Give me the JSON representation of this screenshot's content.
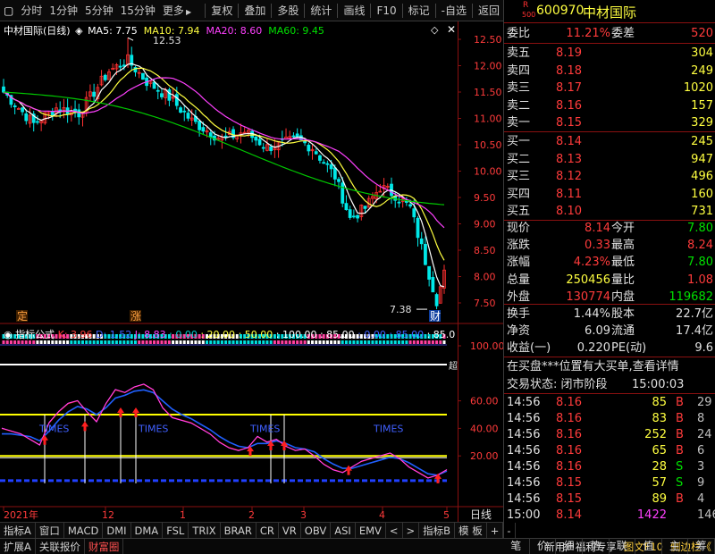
{
  "toolbar": {
    "periods": [
      "分时",
      "1分钟",
      "5分钟",
      "15分钟",
      "更多"
    ],
    "more_arrow": "▶",
    "tools": [
      "复权",
      "叠加",
      "多股",
      "统计",
      "画线",
      "F10",
      "标记",
      "-自选",
      "返回"
    ]
  },
  "main_legend": {
    "title": "中材国际(日线)",
    "ma5": "MA5: 7.75",
    "ma10": "MA10: 7.94",
    "ma20": "MA20: 8.60",
    "ma60": "MA60: 9.45"
  },
  "price_axis": [
    "12.50",
    "12.00",
    "11.50",
    "11.00",
    "10.50",
    "10.00",
    "9.50",
    "9.00",
    "8.50",
    "8.00",
    "7.50"
  ],
  "annotations": {
    "high": "12.53",
    "low": "7.38",
    "marker_ding": "定",
    "marker_zhang": "涨",
    "marker_cai": "财"
  },
  "ind_legend": {
    "name": "指标公式",
    "k": "K: 3.96",
    "d": "D: 1.52",
    "j": "J: 8.83",
    "v1": ": 0.00",
    "v2": ": 20.00",
    "v3": ": 50.00",
    "v4": ": 100.00",
    "v5": ": 85.00",
    "v6": ": 0.00",
    "v7": ": 85.00",
    "v8": ": 85.0"
  },
  "ind_axis": [
    "100.00",
    "60.00",
    "40.00",
    "20.00"
  ],
  "ind_labels": {
    "times": "TIMES",
    "side": "超"
  },
  "date_axis": [
    "2021年",
    "12",
    "1",
    "2",
    "3",
    "4",
    "5"
  ],
  "date_axis_right": "日线",
  "bottom_tabs": [
    "指标A",
    "窗口",
    "MACD",
    "DMI",
    "DMA",
    "FSL",
    "TRIX",
    "BRAR",
    "CR",
    "VR",
    "OBV",
    "ASI",
    "EMV",
    "<",
    ">",
    "指标B",
    "模 板",
    "+",
    "-"
  ],
  "status_tabs": [
    "扩展A",
    "关联报价",
    "财富圈"
  ],
  "status_news": "新用户福利专享",
  "status_f10": "图文F10",
  "status_side": "侧边栏《",
  "right_tabs": [
    "笔",
    "价",
    "细",
    "势",
    "联",
    "值",
    "主",
    "筹"
  ],
  "stock": {
    "r_label": "R",
    "code_num": "500",
    "code": "600970",
    "name": "中材国际"
  },
  "weibi": {
    "label": "委比",
    "value": "11.21%",
    "label2": "委差",
    "value2": "520"
  },
  "sell": [
    {
      "label": "卖五",
      "price": "8.19",
      "vol": "304"
    },
    {
      "label": "卖四",
      "price": "8.18",
      "vol": "249"
    },
    {
      "label": "卖三",
      "price": "8.17",
      "vol": "1020"
    },
    {
      "label": "卖二",
      "price": "8.16",
      "vol": "157"
    },
    {
      "label": "卖一",
      "price": "8.15",
      "vol": "329"
    }
  ],
  "buy": [
    {
      "label": "买一",
      "price": "8.14",
      "vol": "245"
    },
    {
      "label": "买二",
      "price": "8.13",
      "vol": "947"
    },
    {
      "label": "买三",
      "price": "8.12",
      "vol": "496"
    },
    {
      "label": "买四",
      "price": "8.11",
      "vol": "160"
    },
    {
      "label": "买五",
      "price": "8.10",
      "vol": "731"
    }
  ],
  "quote": [
    {
      "l1": "现价",
      "v1": "8.14",
      "l2": "今开",
      "v2": "7.80"
    },
    {
      "l1": "涨跌",
      "v1": "0.33",
      "l2": "最高",
      "v2": "8.24"
    },
    {
      "l1": "涨幅",
      "v1": "4.23%",
      "l2": "最低",
      "v2": "7.80"
    },
    {
      "l1": "总量",
      "v1": "250456",
      "l2": "量比",
      "v2": "1.08"
    },
    {
      "l1": "外盘",
      "v1": "130774",
      "l2": "内盘",
      "v2": "119682"
    }
  ],
  "stats": [
    {
      "l1": "换手",
      "v1": "1.44%",
      "l2": "股本",
      "v2": "22.7亿"
    },
    {
      "l1": "净资",
      "v1": "6.09",
      "l2": "流通",
      "v2": "17.4亿"
    },
    {
      "l1": "收益(一)",
      "v1": "0.220",
      "l2": "PE(动)",
      "v2": "9.6"
    }
  ],
  "notice": "在买盘***位置有大买单,查看详情",
  "trade_status": {
    "label": "交易状态: 闭市阶段",
    "time": "15:00:03"
  },
  "ticks": [
    {
      "t": "14:56",
      "p": "8.16",
      "v": "85",
      "bs": "B",
      "n": "29"
    },
    {
      "t": "14:56",
      "p": "8.16",
      "v": "83",
      "bs": "B",
      "n": "8"
    },
    {
      "t": "14:56",
      "p": "8.16",
      "v": "252",
      "bs": "B",
      "n": "24"
    },
    {
      "t": "14:56",
      "p": "8.16",
      "v": "65",
      "bs": "B",
      "n": "6"
    },
    {
      "t": "14:56",
      "p": "8.16",
      "v": "28",
      "bs": "S",
      "n": "3"
    },
    {
      "t": "14:56",
      "p": "8.15",
      "v": "57",
      "bs": "S",
      "n": "9"
    },
    {
      "t": "14:56",
      "p": "8.15",
      "v": "89",
      "bs": "B",
      "n": "4"
    },
    {
      "t": "15:00",
      "p": "8.14",
      "v": "1422",
      "bs": "",
      "n": "146"
    }
  ]
}
